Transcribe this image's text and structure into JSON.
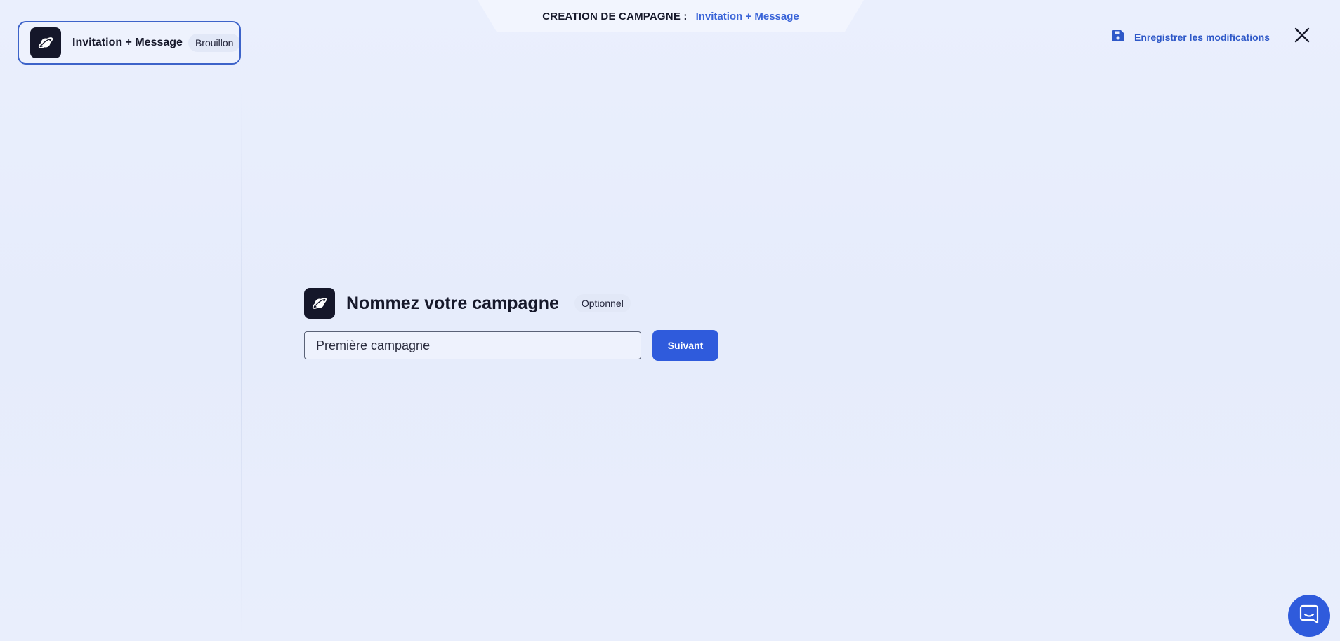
{
  "header": {
    "prefix": "CREATION DE CAMPAGNE :",
    "campaign_name": "Invitation + Message"
  },
  "campaign_chip": {
    "name": "Invitation + Message",
    "status": "Brouillon",
    "icon": "planet-icon"
  },
  "toolbar": {
    "save_label": "Enregistrer les modifications",
    "save_icon": "floppy-disk-icon",
    "close_icon": "close-icon"
  },
  "name_step": {
    "icon": "planet-icon",
    "title": "Nommez votre campagne",
    "optional_badge": "Optionnel",
    "input_value": "Première campagne",
    "next_label": "Suivant"
  },
  "chat": {
    "icon": "chat-icon"
  },
  "colors": {
    "accent": "#2f5bdc",
    "link": "#2e58c8",
    "dark": "#15172a",
    "background": "#e8edfc"
  }
}
